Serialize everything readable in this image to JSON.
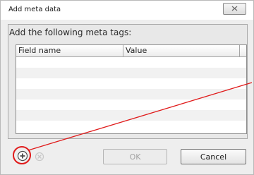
{
  "dialog": {
    "title": "Add meta data",
    "close_icon": "close-icon",
    "prompt": "Add the following meta tags:"
  },
  "table": {
    "columns": [
      "Field name",
      "Value"
    ],
    "rows": [
      [
        "",
        ""
      ],
      [
        "",
        ""
      ],
      [
        "",
        ""
      ],
      [
        "",
        ""
      ],
      [
        "",
        ""
      ],
      [
        "",
        ""
      ],
      [
        "",
        ""
      ]
    ]
  },
  "toolbar": {
    "add_icon": "add-icon",
    "remove_icon": "remove-icon",
    "ok_label": "OK",
    "cancel_label": "Cancel"
  },
  "colors": {
    "annotation": "#e01b1b",
    "add_icon": "#4a4a4a"
  }
}
